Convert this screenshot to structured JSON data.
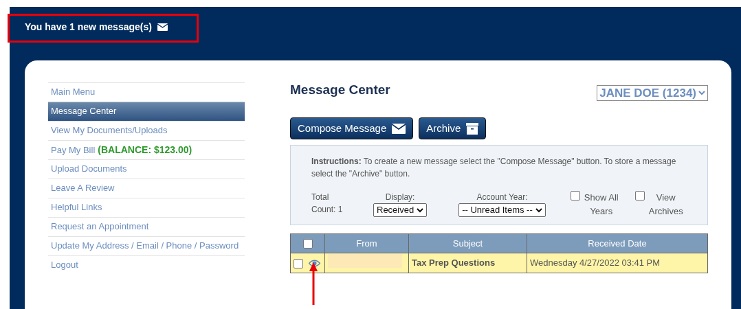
{
  "banner": {
    "text": "You have 1 new message(s)"
  },
  "sidebar": {
    "items": [
      {
        "label": "Main Menu",
        "selected": false
      },
      {
        "label": "Message Center",
        "selected": true
      },
      {
        "label": "View My Documents/Uploads",
        "selected": false
      },
      {
        "label": "Pay My Bill",
        "selected": false,
        "balance": "(BALANCE: $123.00)"
      },
      {
        "label": "Upload Documents",
        "selected": false
      },
      {
        "label": "Leave A Review",
        "selected": false
      },
      {
        "label": "Helpful Links",
        "selected": false
      },
      {
        "label": "Request an Appointment",
        "selected": false
      },
      {
        "label": "Update My Address / Email / Phone / Password",
        "selected": false
      },
      {
        "label": "Logout",
        "selected": false
      }
    ]
  },
  "title": "Message Center",
  "account": "JANE DOE (1234)",
  "buttons": [
    {
      "label": "Compose Message",
      "kind": "envelope"
    },
    {
      "label": "Archive",
      "kind": "box"
    }
  ],
  "instructions": "**Instructions:** To create a new message select the \"Compose Message\" button. To store a message select the \"Archive\" button.",
  "filters": {
    "total": "Total Count: 1",
    "display_label": "Display:",
    "display_value": "Received",
    "year_label": "Account Year:",
    "year_value": "-- Unread Items --",
    "checks": [
      {
        "label": "Show All Years",
        "checked": false
      },
      {
        "label": "View Archives",
        "checked": false
      }
    ]
  },
  "table": {
    "columns": [
      "From",
      "Subject",
      "Received Date"
    ],
    "select_all": false,
    "rows": [
      {
        "checked": false,
        "unread": true,
        "subject": "Tax Prep Questions",
        "date": "Wednesday 4/27/2022 03:41 PM"
      }
    ]
  }
}
